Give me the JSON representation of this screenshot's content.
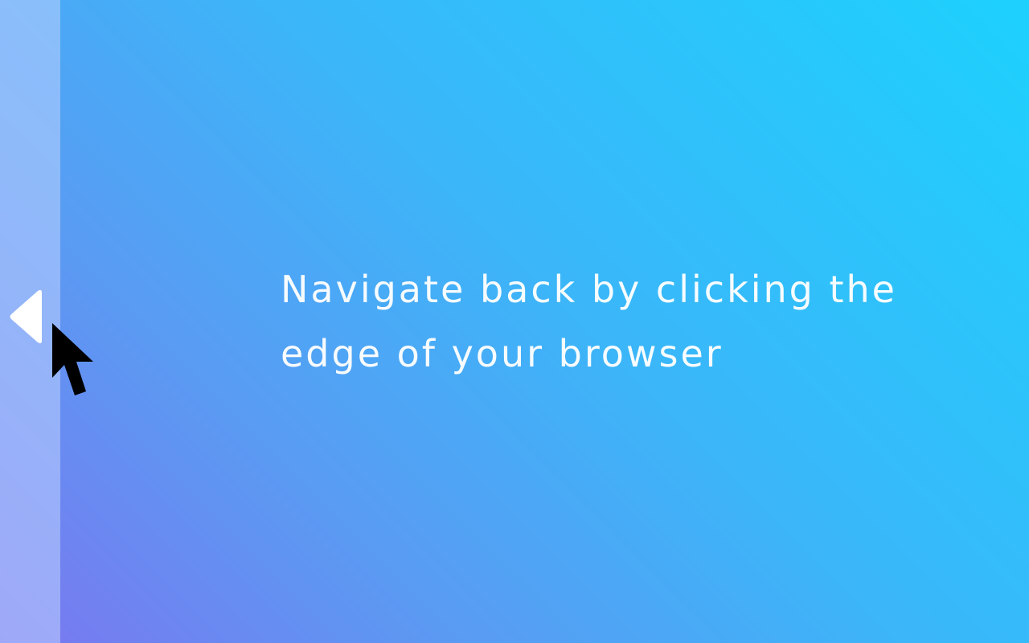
{
  "hint": {
    "line1": "Navigate back by clicking the",
    "line2": "edge of your browser"
  },
  "edge": {
    "icon": "back-arrow-icon",
    "action": "navigate-back"
  },
  "cursor": {
    "icon": "mouse-pointer-icon"
  },
  "colors": {
    "gradient_start": "#7a77ef",
    "gradient_end": "#1dd1fd",
    "edge_strip": "#9fb4f9",
    "text": "#ffffff"
  }
}
